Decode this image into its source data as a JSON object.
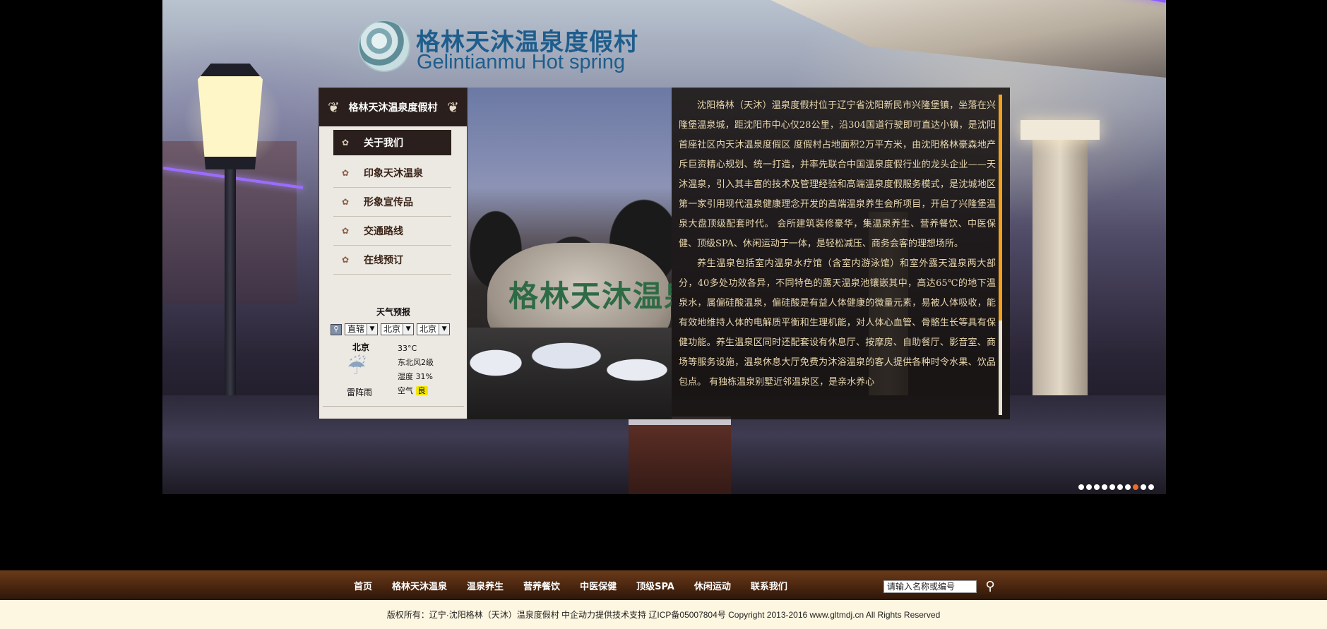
{
  "logo": {
    "name_cn": "格林天沐温泉度假村",
    "name_en": "Gelintianmu Hot spring"
  },
  "sidebar": {
    "title": "格林天沐温泉度假村",
    "menu": [
      {
        "label": "关于我们",
        "active": true
      },
      {
        "label": "印象天沐温泉",
        "active": false
      },
      {
        "label": "形象宣传品",
        "active": false
      },
      {
        "label": "交通路线",
        "active": false
      },
      {
        "label": "在线预订",
        "active": false
      }
    ]
  },
  "weather": {
    "title": "天气预报",
    "selects": [
      "直辖",
      "北京",
      "北京"
    ],
    "city": "北京",
    "description": "雷阵雨",
    "temperature": "33°C",
    "wind": "东北风2级",
    "humidity": "湿度 31%",
    "air_label": "空气",
    "air_quality": "良",
    "icon": "thunder-rain-icon"
  },
  "photo": {
    "stone_text": "格林天沐温泉"
  },
  "intro": {
    "paragraphs": [
      "沈阳格林（天沐）温泉度假村位于辽宁省沈阳新民市兴隆堡镇，坐落在兴隆堡温泉城，距沈阳市中心仅28公里，沿304国道行驶即可直达小镇，是沈阳首座社区内天沐温泉度假区 度假村占地面积2万平方米，由沈阳格林豪森地产斥巨资精心规划、统一打造，并率先联合中国温泉度假行业的龙头企业——天沐温泉，引入其丰富的技术及管理经验和高端温泉度假服务模式，是沈城地区第一家引用现代温泉健康理念开发的高端温泉养生会所项目，开启了兴隆堡温泉大盘顶级配套时代。 会所建筑装修豪华，集温泉养生、营养餐饮、中医保健、顶级SPA、休闲运动于一体，是轻松减压、商务会客的理想场所。",
      "养生温泉包括室内温泉水疗馆（含室内游泳馆）和室外露天温泉两大部分，40多处功效各异，不同特色的露天温泉池镶嵌其中，高达65℃的地下温泉水，属偏硅酸温泉，偏硅酸是有益人体健康的微量元素，易被人体吸收，能有效地维持人体的电解质平衡和生理机能，对人体心血管、骨骼生长等具有保健功能。养生温泉区同时还配套设有休息厅、按摩房、自助餐厅、影音室、商场等服务设施，温泉休息大厅免费为沐浴温泉的客人提供各种时令水果、饮品包点。 有独栋温泉别墅近邻温泉区，是亲水养心"
    ]
  },
  "slider": {
    "count": 10,
    "active_index": 7
  },
  "nav": {
    "items": [
      "首页",
      "格林天沐温泉",
      "温泉养生",
      "营养餐饮",
      "中医保健",
      "顶级SPA",
      "休闲运动",
      "联系我们"
    ]
  },
  "search": {
    "placeholder": "请输入名称或编号",
    "icon": "search-icon"
  },
  "footer": {
    "text": "版权所有：辽宁·沈阳格林（天沐）温泉度假村  中企动力提供技术支持  辽ICP备05007804号  Copyright 2013-2016   www.gltmdj.cn  All Rights Reserved"
  },
  "colors": {
    "sidebar_dark": "#2a1f1c",
    "intro_text": "#e9d8ae",
    "scroll_thumb": "#f2a11f",
    "nav_bar": "#4a260f",
    "footer_bg": "#fdf6e0",
    "slider_active": "#e86d2a"
  }
}
